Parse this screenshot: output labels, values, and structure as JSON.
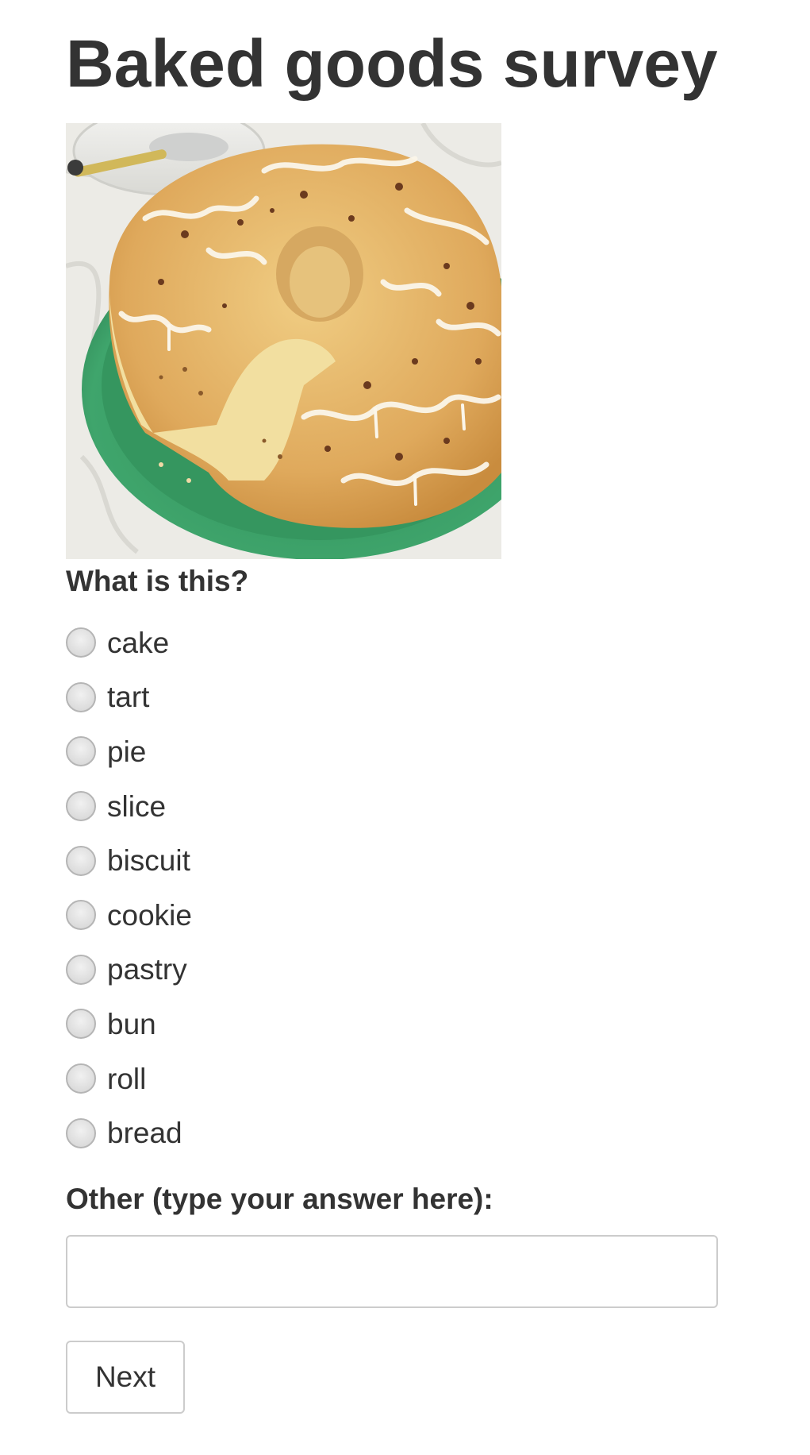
{
  "page": {
    "title": "Baked goods survey"
  },
  "image": {
    "subject": "glazed-pull-apart-bread-ring",
    "colors": {
      "plate": "#3a9a63",
      "cloth": "#ecebe6",
      "crust": "#e4b76a",
      "crumb": "#f2dfa0",
      "glaze": "#fbf6ea",
      "pecan": "#6b3a1e"
    }
  },
  "question": {
    "label": "What is this?",
    "options": [
      "cake",
      "tart",
      "pie",
      "slice",
      "biscuit",
      "cookie",
      "pastry",
      "bun",
      "roll",
      "bread"
    ]
  },
  "other": {
    "label": "Other (type your answer here):",
    "value": "",
    "placeholder": ""
  },
  "actions": {
    "next_label": "Next"
  }
}
